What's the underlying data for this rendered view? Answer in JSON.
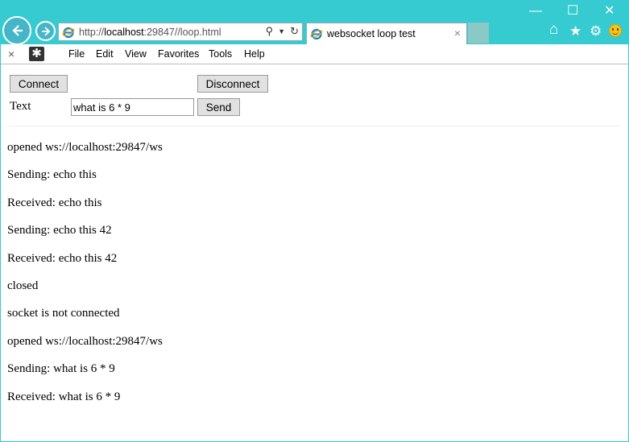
{
  "browser": {
    "url_path": "http://",
    "url_host": "localhost",
    "url_rest": ":29847//loop.html",
    "tab_title": "websocket loop test",
    "tab_close": "×",
    "window_controls": {
      "minimize": "—",
      "maximize": "☐",
      "close": "✕"
    },
    "toolbar_icons": {
      "home": "⌂",
      "favorites": "★",
      "settings": "⚙"
    }
  },
  "menubar": {
    "close_glyph": "×",
    "extension_glyph": "✱",
    "items": [
      "File",
      "Edit",
      "View",
      "Favorites",
      "Tools",
      "Help"
    ]
  },
  "controls": {
    "connect_label": "Connect",
    "disconnect_label": "Disconnect",
    "text_label": "Text",
    "input_value": "what is 6 * 9",
    "send_label": "Send"
  },
  "log": [
    "opened ws://localhost:29847/ws",
    "Sending: echo this",
    "Received: echo this",
    "Sending: echo this 42",
    "Received: echo this 42",
    "closed",
    "socket is not connected",
    "opened ws://localhost:29847/ws",
    "Sending: what is 6 * 9",
    "Received: what is 6 * 9"
  ],
  "colors": {
    "chrome": "#35cbd1",
    "button_face": "#e1e1e1"
  }
}
